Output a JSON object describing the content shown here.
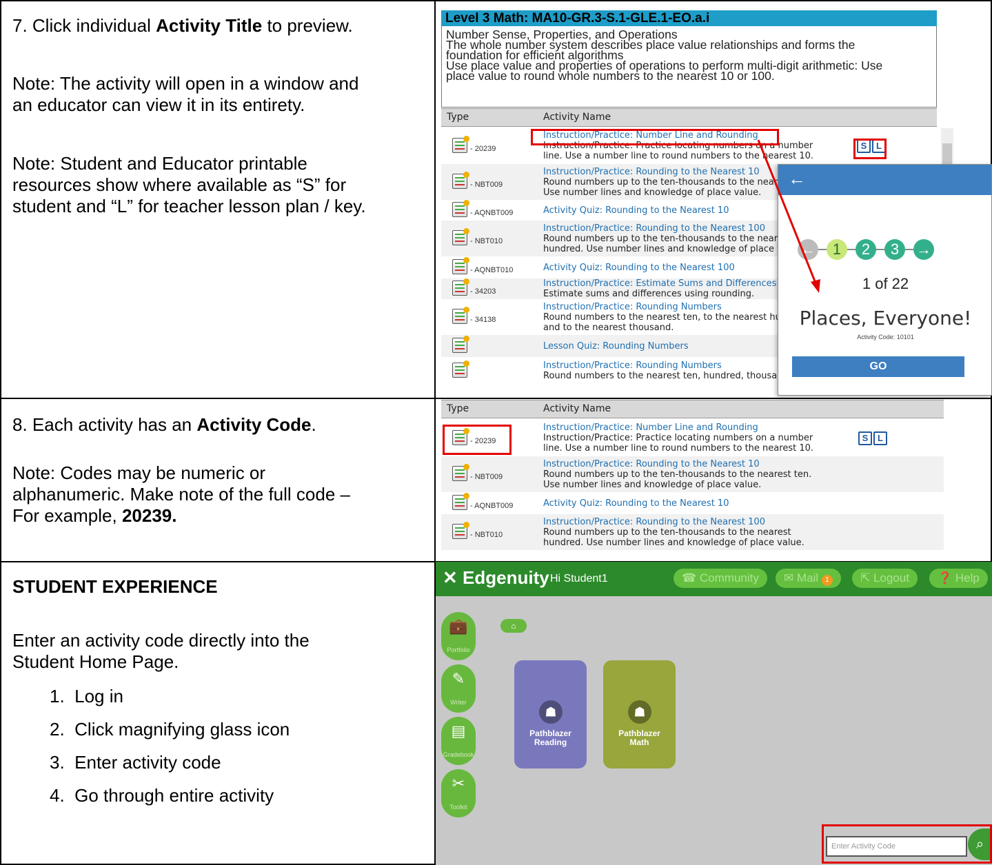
{
  "row7": {
    "intro_pre": "7. Click individual ",
    "intro_bold": "Activity Title",
    "intro_post": " to preview.",
    "note1_l1": "Note: The activity will open in a window and",
    "note1_l2": "an educator can view it in its entirety.",
    "note2_l1": "Note: Student and Educator printable",
    "note2_l2": "resources show where available as “S” for",
    "note2_l3": "student and “L” for teacher lesson plan / key."
  },
  "standard": {
    "header": "Level 3 Math: MA10-GR.3-S.1-GLE.1-EO.a.i",
    "lines": [
      "Number Sense, Properties, and Operations",
      "The whole number system describes place value relationships and forms the",
      "foundation for efficient algorithms",
      "Use place value and properties of operations to perform multi-digit arithmetic: Use",
      "place value to round whole numbers to the nearest 10 or 100."
    ]
  },
  "table_headers": {
    "type": "Type",
    "name": "Activity Name"
  },
  "activities_full": [
    {
      "code": "- 20239",
      "title": "Instruction/Practice: Number Line and Rounding",
      "desc": [
        "Instruction/Practice: Practice locating numbers on a number",
        "line. Use a number line to round numbers to the nearest 10."
      ]
    },
    {
      "code": "- NBT009",
      "title": "Instruction/Practice: Rounding to the Nearest 10",
      "desc": [
        "Round numbers up to the ten-thousands to the nearest ten.",
        "Use number lines and knowledge of place value."
      ]
    },
    {
      "code": "- AQNBT009",
      "title": "Activity Quiz: Rounding to the Nearest 10",
      "desc": []
    },
    {
      "code": "- NBT010",
      "title": "Instruction/Practice: Rounding to the Nearest 100",
      "desc": [
        "Round numbers up to the ten-thousands to the nearest",
        "hundred. Use number lines and knowledge of place value."
      ]
    },
    {
      "code": "- AQNBT010",
      "title": "Activity Quiz: Rounding to the Nearest 100",
      "desc": []
    },
    {
      "code": "- 34203",
      "title": "Instruction/Practice: Estimate Sums and Differences",
      "desc": [
        "Estimate sums and differences using rounding."
      ]
    },
    {
      "code": "- 34138",
      "title": "Instruction/Practice: Rounding Numbers",
      "desc": [
        "Round numbers to the nearest ten, to the nearest hundred,",
        "and to the nearest thousand."
      ]
    },
    {
      "code": "",
      "title": "Lesson Quiz: Rounding Numbers",
      "desc": []
    },
    {
      "code": "",
      "title": "Instruction/Practice: Rounding Numbers",
      "desc": [
        "Round numbers to the nearest ten, hundred, thousand"
      ]
    }
  ],
  "resource_badges": {
    "s": "S",
    "l": "L"
  },
  "popup": {
    "back_arrow": "←",
    "nav": [
      "←",
      "1",
      "2",
      "3",
      "→"
    ],
    "counter": "1 of 22",
    "title": "Places, Everyone!",
    "code_line": "Activity Code: 10101",
    "go": "GO"
  },
  "row8": {
    "intro_pre": "8. Each activity has an ",
    "intro_bold": "Activity Code",
    "intro_post": ".",
    "note_l1": "Note: Codes may be numeric or",
    "note_l2": "alphanumeric. Make note of the full code –",
    "note_l3_pre": "For example, ",
    "note_l3_bold": "20239."
  },
  "student": {
    "heading": "STUDENT EXPERIENCE",
    "intro_l1": "Enter an activity code directly into the",
    "intro_l2": "Student Home Page.",
    "steps": [
      {
        "n": "1.",
        "text": "Log in"
      },
      {
        "n": "2.",
        "text": "Click magnifying glass icon"
      },
      {
        "n": "3.",
        "text": "Enter activity code"
      },
      {
        "n": "4.",
        "text": "Go through entire activity"
      }
    ]
  },
  "edgenuity": {
    "logo": "Edgenuity",
    "greeting": "Hi Student1",
    "nav": {
      "community": "Community",
      "mail": "Mail",
      "mail_count": "1",
      "logout": "Logout",
      "help": "Help"
    },
    "sidebar": [
      "Portfolio",
      "Writer",
      "Gradebook",
      "Toolkit"
    ],
    "tiles": [
      {
        "name1": "Pathblazer",
        "name2": "Reading",
        "color": "#7a78bd"
      },
      {
        "name1": "Pathblazer",
        "name2": "Math",
        "color": "#98a63c"
      }
    ],
    "search_placeholder": "Enter Activity Code"
  },
  "colors": {
    "highlight": "#e30000",
    "edg_green": "#2c8a2b",
    "popup_blue": "#3d7fc1"
  }
}
